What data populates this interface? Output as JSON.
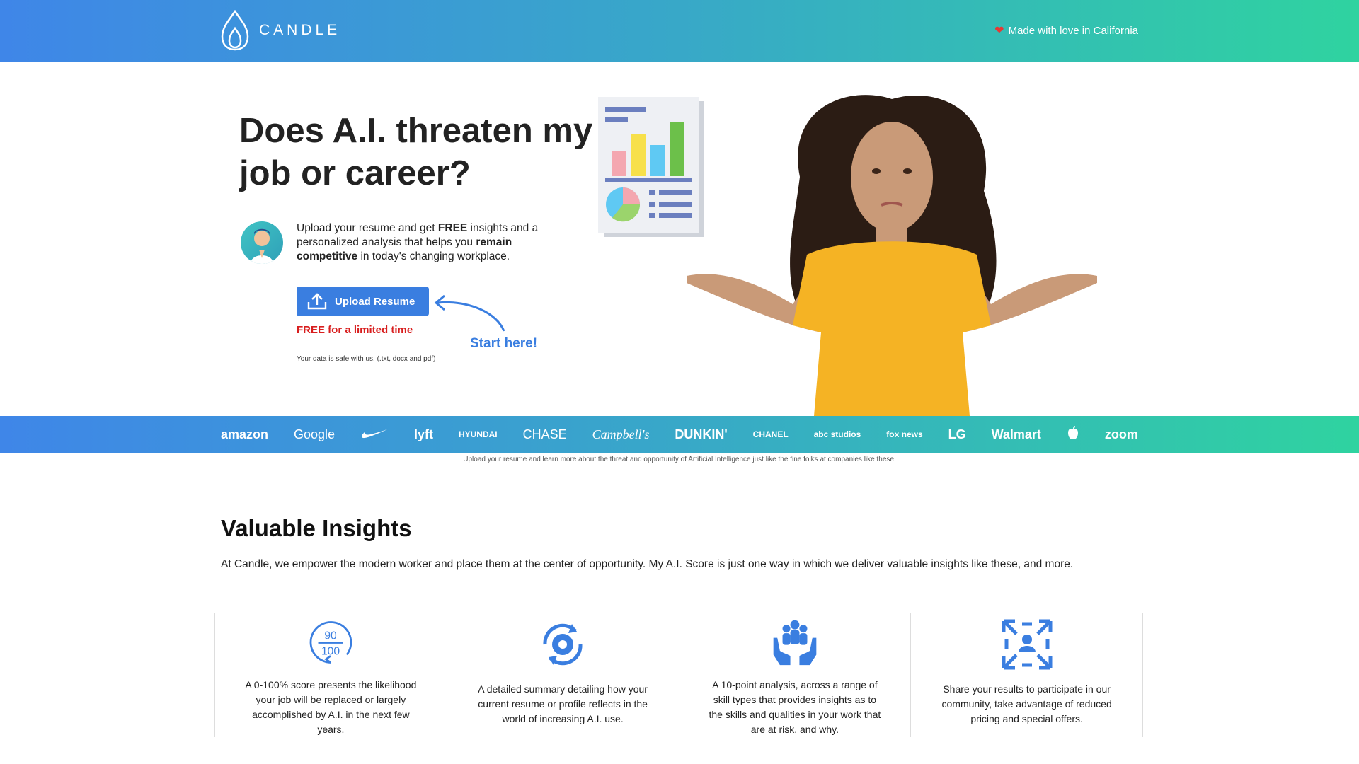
{
  "header": {
    "logo_text": "CANDLE",
    "tagline": "Made with love in California",
    "colors": {
      "gradient_start": "#3f86e8",
      "gradient_end": "#2fd3a0"
    }
  },
  "hero": {
    "title": "Does A.I. threaten my job or career?",
    "intro": {
      "part1": "Upload your resume and get ",
      "free": "FREE",
      "part2": " insights and a personalized analysis that helps you ",
      "remain": "remain competitive",
      "part3": " in today's changing workplace."
    },
    "upload_button_label": "Upload Resume",
    "free_notice": "FREE for a limited time",
    "safe_notice": "Your data is safe with us. (.txt, docx and pdf)",
    "start_here": "Start here!"
  },
  "logos": [
    "amazon",
    "Google",
    "NIKE",
    "lyft",
    "HYUNDAI",
    "CHASE",
    "Campbell's",
    "DUNKIN'",
    "CHANEL",
    "abc studios",
    "fox news",
    "LG",
    "Walmart",
    "apple",
    "zoom"
  ],
  "logos_caption": "Upload your resume and learn more about the threat and opportunity of Artificial Intelligence just like the fine folks at companies like these.",
  "insights": {
    "title": "Valuable Insights",
    "description": "At Candle, we empower the modern worker and place them at the center of opportunity. My A.I. Score is just one way in which we deliver valuable insights like these, and more.",
    "features": [
      {
        "icon": "score-gauge-icon",
        "score_top": "90",
        "score_bottom": "100",
        "text": "A 0-100% score presents the likelihood your job will be replaced or largely accomplished by A.I. in the next few years."
      },
      {
        "icon": "gear-cycle-icon",
        "text": "A detailed summary detailing how your current resume or profile reflects in the world of increasing A.I. use."
      },
      {
        "icon": "hands-people-icon",
        "text": "A 10-point analysis, across a range of skill types that provides insights as to the skills and qualities in your work that are at risk, and why."
      },
      {
        "icon": "network-expand-icon",
        "text": "Share your results to participate in our community, take advantage of reduced pricing and special offers."
      }
    ]
  }
}
